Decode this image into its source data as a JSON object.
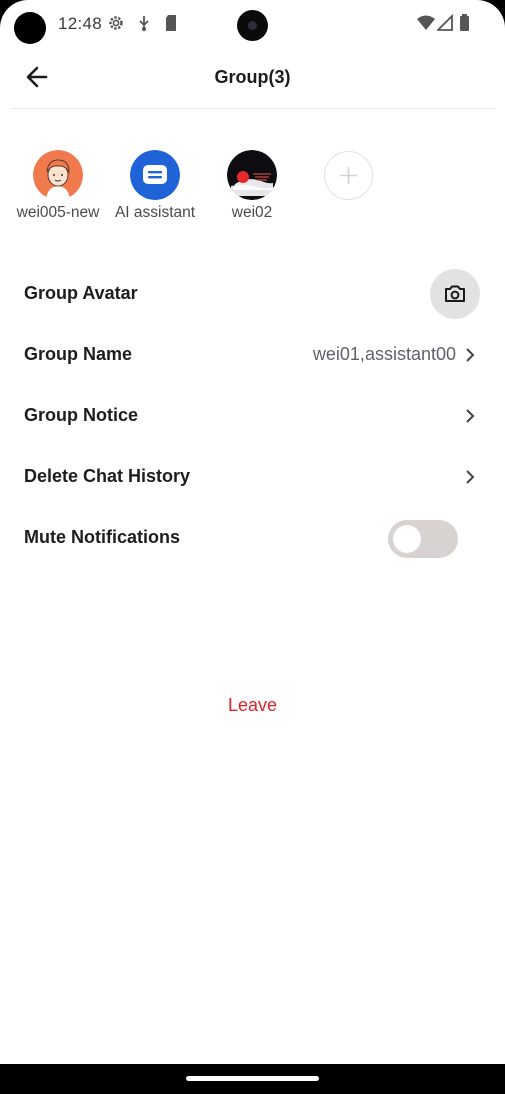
{
  "status_bar": {
    "time": "12:48",
    "icons": [
      "gear-icon",
      "usb-debug-icon",
      "sd-card-icon",
      "wifi-icon",
      "signal-icon",
      "battery-icon"
    ]
  },
  "header": {
    "title": "Group(3)",
    "back_icon": "arrow-left-icon"
  },
  "members": [
    {
      "name": "wei005-new",
      "avatar": "cartoon-avatar"
    },
    {
      "name": "AI assistant",
      "avatar": "chat-bubble-avatar"
    },
    {
      "name": "wei02",
      "avatar": "photo-avatar"
    }
  ],
  "add_member_icon": "plus-icon",
  "settings": {
    "group_avatar": {
      "label": "Group Avatar",
      "icon": "camera-icon"
    },
    "group_name": {
      "label": "Group Name",
      "value": "wei01,assistant00"
    },
    "group_notice": {
      "label": "Group Notice"
    },
    "delete_history": {
      "label": "Delete Chat History"
    },
    "mute": {
      "label": "Mute Notifications",
      "enabled": false
    }
  },
  "leave_label": "Leave",
  "colors": {
    "accent_red": "#e0212b",
    "ai_blue": "#1f63d6",
    "avatar_orange": "#f07a4e",
    "toggle_off": "#d8d2d0"
  }
}
